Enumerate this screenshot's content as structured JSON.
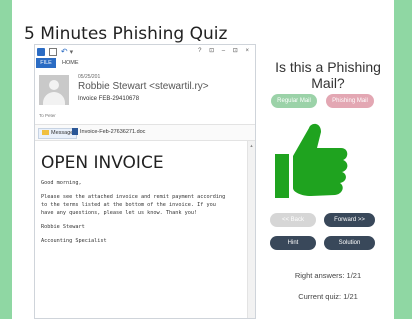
{
  "page": {
    "title": "5 Minutes Phishing Quiz"
  },
  "email_window": {
    "ribbon_tabs": {
      "file": "FILE",
      "home": "HOME"
    },
    "window_controls": "? ⊡ – ⊡ ×",
    "header": {
      "date": "05/25/201",
      "sender": "Robbie Stewart <stewartil.ry>",
      "subject": "Invoice FEB-29410678",
      "to": "To Peter"
    },
    "attachments": {
      "message_label": "Message",
      "file_name": "Invoice-Feb-27636271.doc"
    },
    "body": {
      "title": "OPEN INVOICE",
      "greeting": "Good morning,",
      "paragraph": "Please see the attached invoice and remit payment according\nto the terms listed at the bottom of the invoice. If you\nhave any questions, please let us know. Thank you!",
      "signature_name": "Robbie Stewart",
      "signature_title": "Accounting Specialist"
    }
  },
  "quiz": {
    "question": "Is this a Phishing Mail?",
    "regular_button": "Regular Mail",
    "phishing_button": "Phishing Mail",
    "back_button": "<< Back",
    "forward_button": "Forward >>",
    "hint_button": "Hint",
    "solution_button": "Solution",
    "right_answers": "Right answers: 1/21",
    "current_quiz": "Current quiz: 1/21",
    "thumb_icon": "thumbs-up-icon",
    "thumb_color": "#1fa31f"
  },
  "colors": {
    "background": "#8fd7a3",
    "dark_button": "#39485a",
    "regular_button": "#9bd2a8",
    "phishing_button": "#e3a7b3",
    "disabled_button": "#d6d6d6",
    "ribbon_blue": "#2b6cc4"
  }
}
